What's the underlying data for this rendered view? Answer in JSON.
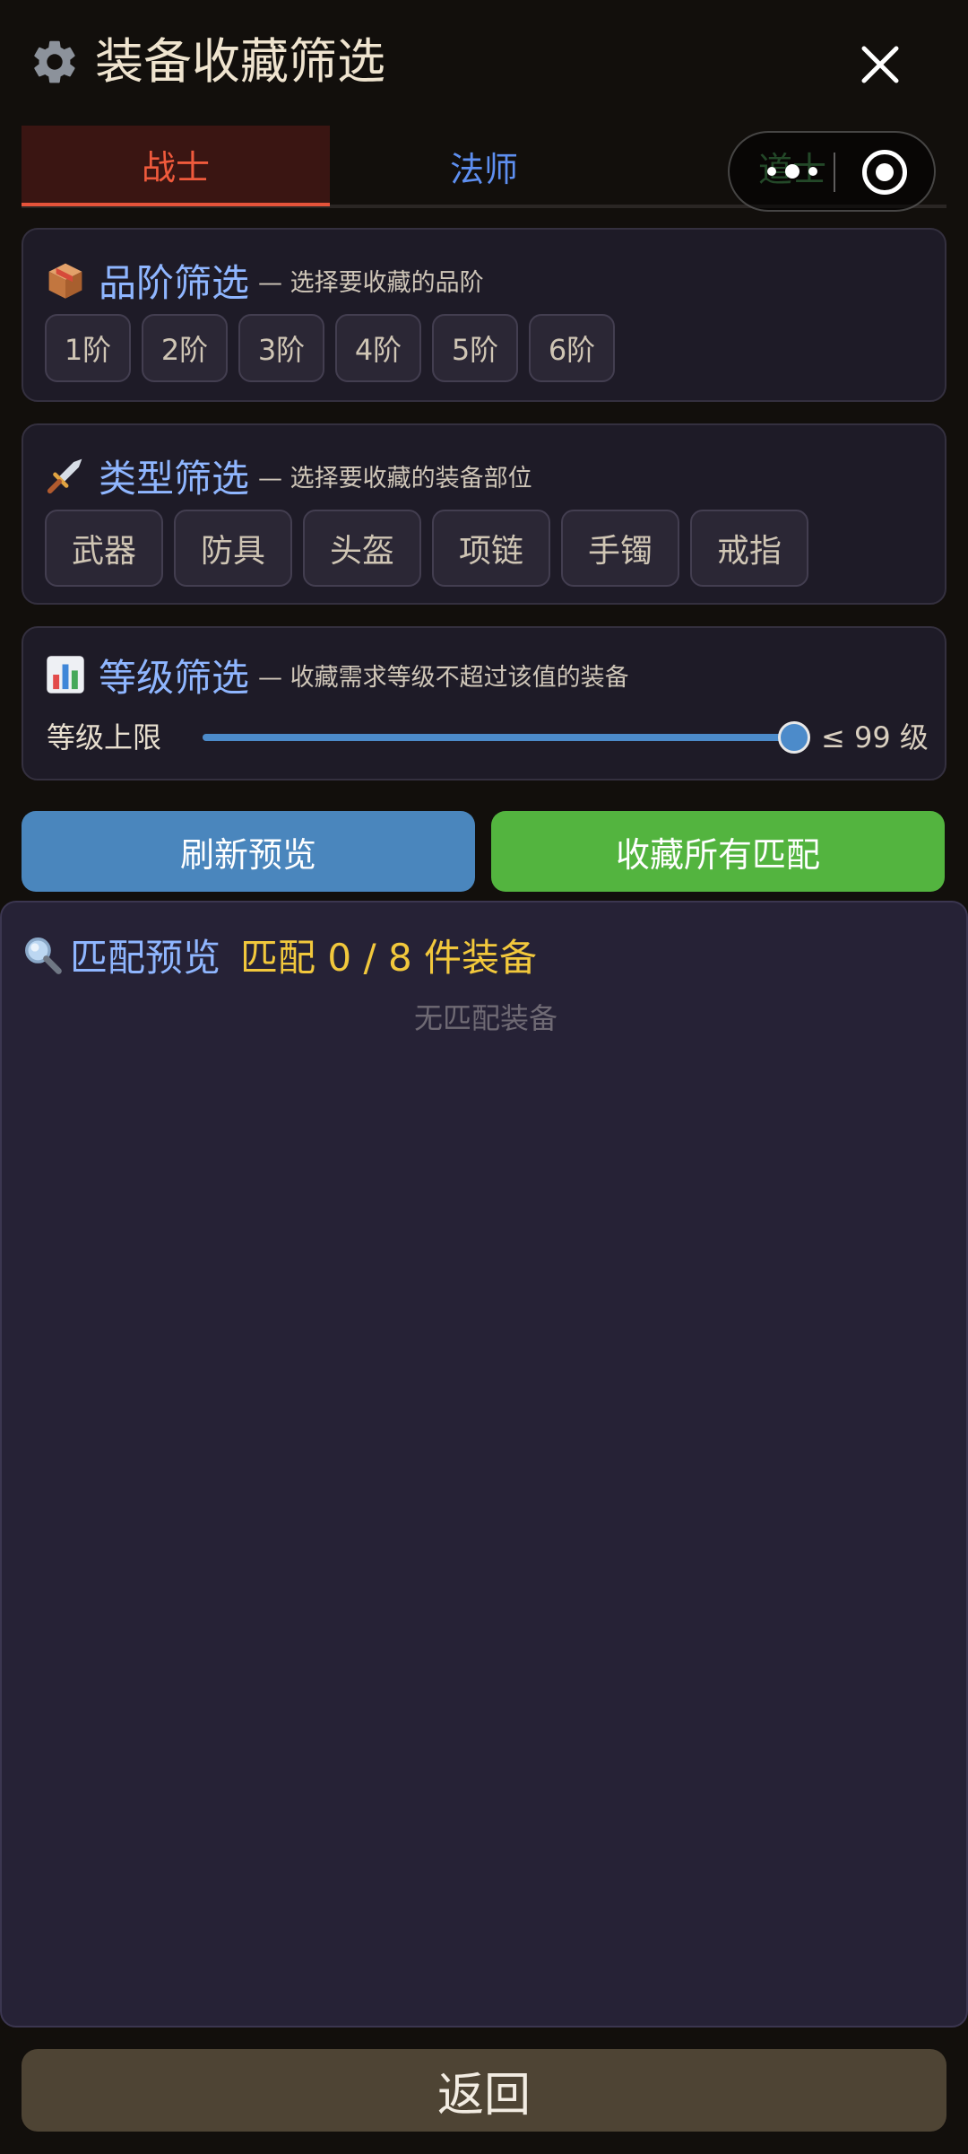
{
  "header": {
    "title": "装备收藏筛选"
  },
  "tabs": [
    {
      "label": "战士",
      "active": true
    },
    {
      "label": "法师",
      "active": false
    },
    {
      "label": "道士",
      "active": false
    }
  ],
  "grade_filter": {
    "title": "品阶筛选",
    "desc": "— 选择要收藏的品阶",
    "options": [
      "1阶",
      "2阶",
      "3阶",
      "4阶",
      "5阶",
      "6阶"
    ]
  },
  "type_filter": {
    "title": "类型筛选",
    "desc": "— 选择要收藏的装备部位",
    "options": [
      "武器",
      "防具",
      "头盔",
      "项链",
      "手镯",
      "戒指"
    ]
  },
  "level_filter": {
    "title": "等级筛选",
    "desc": "— 收藏需求等级不超过该值的装备",
    "slider_label": "等级上限",
    "value_text": "≤ 99 级",
    "slider_fraction": 1.0
  },
  "actions": {
    "refresh": "刷新预览",
    "collect_all": "收藏所有匹配"
  },
  "preview": {
    "title": "匹配预览",
    "count": "匹配 0 / 8 件装备",
    "empty": "无匹配装备"
  },
  "footer": {
    "back": "返回"
  },
  "colors": {
    "accent_red": "#ef5a3c",
    "accent_blue": "#8fb6ff",
    "accent_yellow": "#f2c83c",
    "refresh_button": "#4a86bd",
    "collect_button": "#53b43f"
  }
}
